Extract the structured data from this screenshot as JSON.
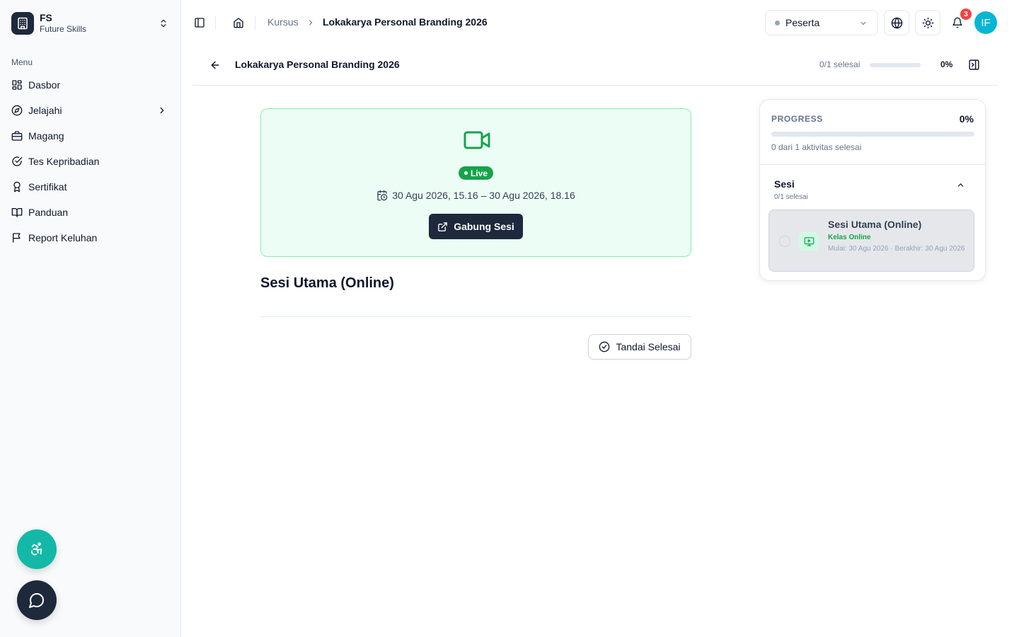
{
  "brand": {
    "short": "FS",
    "name": "Future Skills"
  },
  "sidebar": {
    "menu_title": "Menu",
    "items": [
      {
        "label": "Dasbor",
        "icon": "grid-icon"
      },
      {
        "label": "Jelajahi",
        "icon": "compass-icon",
        "has_submenu": true
      },
      {
        "label": "Magang",
        "icon": "briefcase-icon"
      },
      {
        "label": "Tes Kepribadian",
        "icon": "check-circle-icon"
      },
      {
        "label": "Sertifikat",
        "icon": "award-icon"
      },
      {
        "label": "Panduan",
        "icon": "book-icon"
      },
      {
        "label": "Report Keluhan",
        "icon": "flag-icon"
      }
    ]
  },
  "header": {
    "breadcrumb": {
      "parent": "Kursus",
      "current": "Lokakarya Personal Branding 2026"
    },
    "role": "Peserta",
    "notification_count": "3",
    "avatar_initials": "IF"
  },
  "subheader": {
    "title": "Lokakarya Personal Branding 2026",
    "completed_text": "0/1 selesai",
    "progress_percent": "0%",
    "progress_value": 0
  },
  "live_session": {
    "badge": "Live",
    "time": "30 Agu 2026, 15.16 – 30 Agu 2026, 18.16",
    "join_label": "Gabung Sesi"
  },
  "session_title": "Sesi Utama (Online)",
  "mark_done_label": "Tandai Selesai",
  "progress_panel": {
    "label": "PROGRESS",
    "percent": "0%",
    "progress_value": 0,
    "summary": "0 dari 1 aktivitas selesai",
    "section": {
      "title": "Sesi",
      "subtitle": "0/1 selesai",
      "items": [
        {
          "title": "Sesi Utama (Online)",
          "type": "Kelas Online",
          "dates": "Mulai: 30 Agu 2026 · Berakhir: 30 Agu 2026"
        }
      ]
    }
  },
  "colors": {
    "accent": "#14b8a6",
    "live_green": "#16a34a",
    "dark": "#1e293b",
    "badge_red": "#ef4444",
    "avatar": "#06b6d4"
  }
}
